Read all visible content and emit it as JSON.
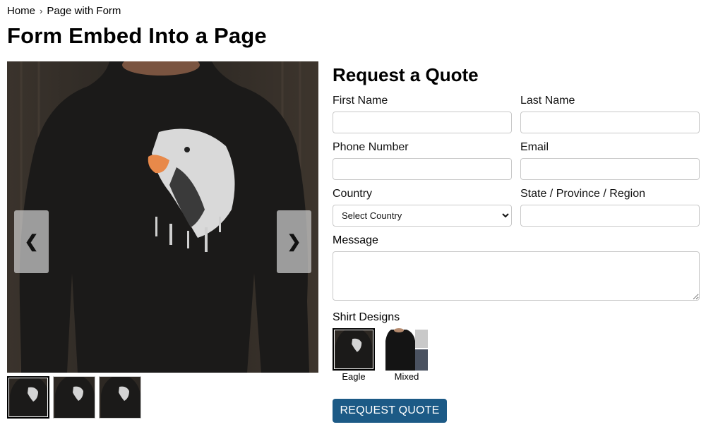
{
  "breadcrumb": {
    "home": "Home",
    "current": "Page with Form"
  },
  "page_title": "Form Embed Into a Page",
  "gallery": {
    "prev": "❮",
    "next": "❯",
    "thumbnail_count": 3
  },
  "form": {
    "title": "Request a Quote",
    "first_name_label": "First Name",
    "last_name_label": "Last Name",
    "phone_label": "Phone Number",
    "email_label": "Email",
    "country_label": "Country",
    "country_selected": "Select Country",
    "state_label": "State / Province / Region",
    "message_label": "Message",
    "designs_label": "Shirt Designs",
    "designs": [
      {
        "name": "Eagle",
        "selected": true
      },
      {
        "name": "Mixed",
        "selected": false
      }
    ],
    "submit_label": "REQUEST QUOTE"
  },
  "colors": {
    "submit_bg": "#1c5a86",
    "shirt": "#1c1b1a"
  }
}
